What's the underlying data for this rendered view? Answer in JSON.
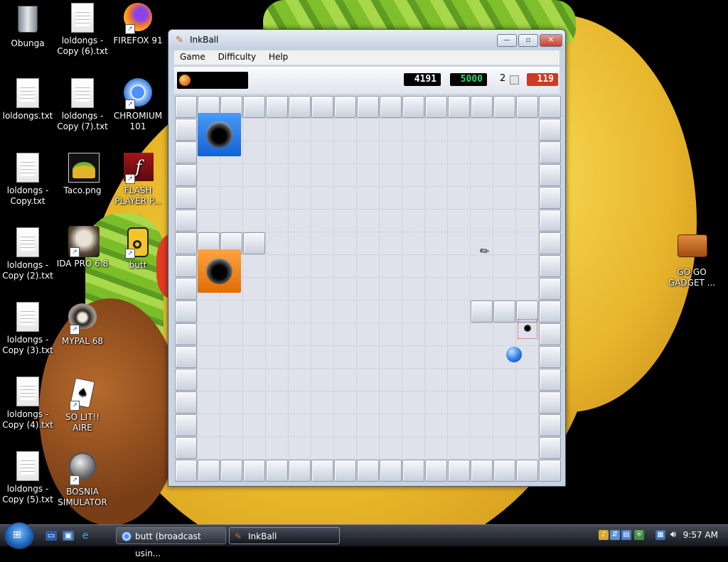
{
  "desktop": {
    "icons": [
      {
        "label": "Obunga",
        "icon": "recycle-bin-icon"
      },
      {
        "label": "loldongs - Copy (6).txt",
        "icon": "text-file-icon"
      },
      {
        "label": "FIREFOX 91",
        "icon": "firefox-icon"
      },
      {
        "label": "loldongs.txt",
        "icon": "text-file-icon"
      },
      {
        "label": "loldongs - Copy (7).txt",
        "icon": "text-file-icon"
      },
      {
        "label": "CHROMIUM 101",
        "icon": "chromium-icon"
      },
      {
        "label": "loldongs - Copy.txt",
        "icon": "text-file-icon"
      },
      {
        "label": "Taco.png",
        "icon": "image-file-icon"
      },
      {
        "label": "FLASH PLAYER P...",
        "icon": "flash-player-icon"
      },
      {
        "label": "loldongs - Copy (2).txt",
        "icon": "text-file-icon"
      },
      {
        "label": "IDA PRO 6.8",
        "icon": "ida-pro-icon"
      },
      {
        "label": "butt",
        "icon": "speaker-icon"
      },
      {
        "label": "loldongs - Copy (3).txt",
        "icon": "text-file-icon"
      },
      {
        "label": "MYPAL 68",
        "icon": "raccoon-icon"
      },
      {
        "label": "loldongs - Copy (4).txt",
        "icon": "text-file-icon"
      },
      {
        "label": "SO LIT!! AIRE",
        "icon": "cards-icon"
      },
      {
        "label": "loldongs - Copy (5).txt",
        "icon": "text-file-icon"
      },
      {
        "label": "BOSNIA SIMULATOR",
        "icon": "spiked-ball-icon"
      },
      {
        "label": "GO GO GADGET ...",
        "icon": "briefcase-icon"
      }
    ]
  },
  "window": {
    "title": "InkBall",
    "controls": {
      "minimize": "—",
      "maximize": "▫",
      "close": "✕"
    },
    "menu": [
      "Game",
      "Difficulty",
      "Help"
    ]
  },
  "game": {
    "score": "4191",
    "target_score": "5000",
    "level": "2",
    "timer": "119",
    "colors": {
      "blue_hole": "#1a6fe6",
      "orange_hole": "#f07f12",
      "ball": "#2f7ee6",
      "timer_bg": "#cc3a22"
    }
  },
  "taskbar": {
    "tasks": [
      {
        "label": "butt (broadcast usin...",
        "icon": "chromium-icon",
        "active": false
      },
      {
        "label": "InkBall",
        "icon": "inkball-icon",
        "active": true
      }
    ],
    "clock": "9:57 AM"
  }
}
